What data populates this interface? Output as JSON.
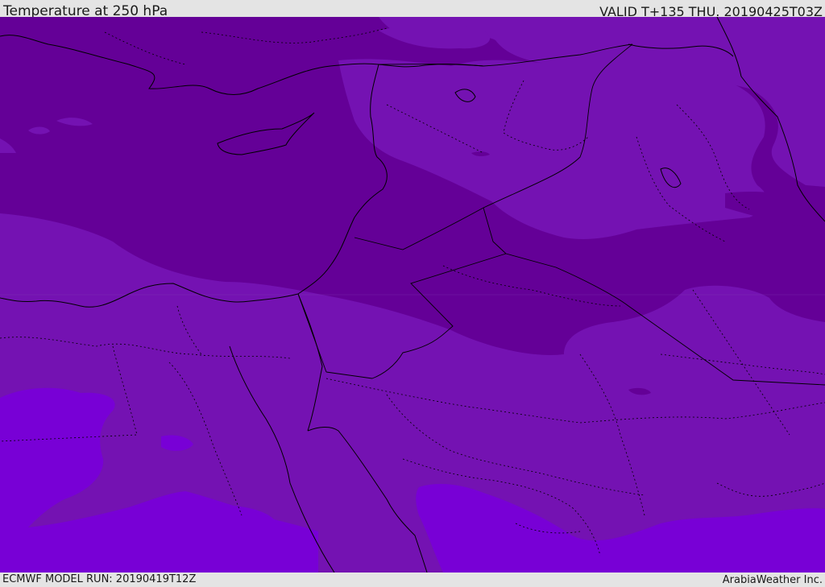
{
  "header": {
    "title": "Temperature at 250 hPa",
    "valid_time": "VALID T+135 THU. 20190425T03Z"
  },
  "footer": {
    "model_run": "ECMWF MODEL RUN: 20190419T12Z",
    "credit": "ArabiaWeather Inc."
  },
  "map": {
    "field": "temperature",
    "level": "250 hPa",
    "colors": {
      "coldest": "#640097",
      "mid": "#7412b2",
      "warm": "#7800d6",
      "borders": "#000000"
    }
  }
}
